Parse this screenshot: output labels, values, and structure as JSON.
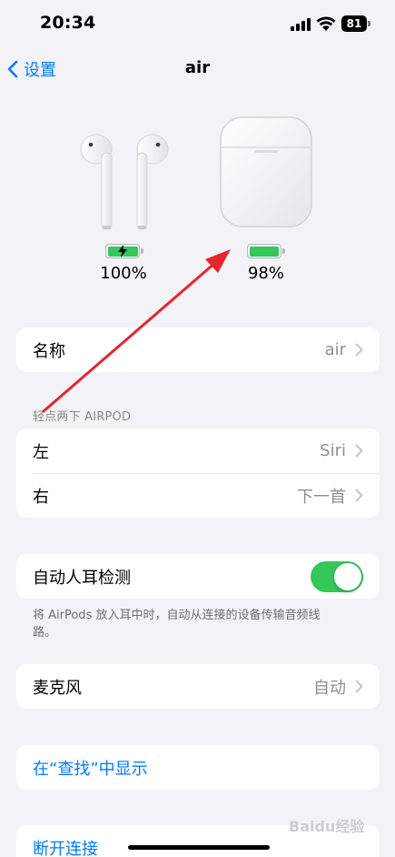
{
  "status": {
    "time": "20:34",
    "battery": "81"
  },
  "nav": {
    "back_label": "设置",
    "title": "air"
  },
  "devices": {
    "buds_percent": "100%",
    "case_percent": "98%",
    "buds_level": 1.0,
    "case_level": 0.98,
    "battery_color": "#34c759"
  },
  "name_row": {
    "label": "名称",
    "value": "air"
  },
  "double_tap": {
    "header": "轻点两下 AIRPOD",
    "left": {
      "label": "左",
      "value": "Siri"
    },
    "right": {
      "label": "右",
      "value": "下一首"
    }
  },
  "ear_detect": {
    "label": "自动人耳检测",
    "enabled": true,
    "footnote": "将 AirPods 放入耳中时，自动从连接的设备传输音频线路。"
  },
  "mic_row": {
    "label": "麦克风",
    "value": "自动"
  },
  "find_row": {
    "label": "在“查找”中显示"
  },
  "disconnect_row": {
    "label": "断开连接"
  },
  "colors": {
    "accent": "#007aff",
    "toggle_on": "#34c759",
    "annotation": "#e8242c"
  },
  "watermark": "Baidu经验"
}
